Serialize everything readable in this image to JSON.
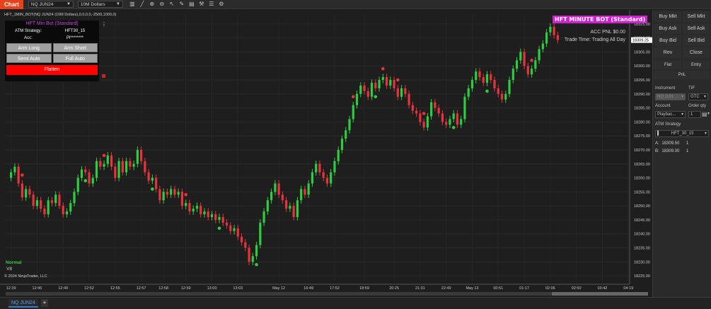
{
  "toolbar": {
    "chart_tab": "Chart",
    "instrument": "NQ JUN24",
    "interval": "10M Dollars",
    "icons": [
      "bar-chart-icon",
      "line-icon",
      "zoom-in-icon",
      "zoom-out-icon",
      "cursor-icon",
      "draw-icon",
      "properties-icon",
      "tools-icon",
      "list-icon",
      "settings-icon"
    ]
  },
  "indicator_label": "HFT_1MIN_BOT(NQ JUN24 (10M Dollars),0,0,0,0,-2500,1000,0)",
  "bot_panel": {
    "title": "HFT Min Bot (Standard)",
    "atm_label": "ATM Strategy:",
    "atm_value": "HFT30_15",
    "acc_label": "Acc:",
    "acc_value": "Pl********",
    "arm_long": "Arm Long",
    "arm_short": "Arm Short",
    "semi_auto": "Semi Auto",
    "full_auto": "Full Auto",
    "flatten": "Flatten"
  },
  "chart_info": {
    "banner": "HFT MINUTE BOT (Standard)",
    "acc_pnl": "ACC PNL $0.00",
    "trade_time": "Trade Time: Trading All Day"
  },
  "status": {
    "mode": "Normal",
    "version": "V8",
    "copyright": "© 2024 NinjaTrader, LLC"
  },
  "bottom_tab": {
    "instrument": "NQ JUN24",
    "add": "+"
  },
  "order_panel": {
    "buttons": [
      "Buy Mkt",
      "Sell Mkt",
      "Buy Ask",
      "Sell Ask",
      "Buy Bid",
      "Sell Bid",
      "Rev",
      "Close"
    ],
    "flat": "Flat",
    "entry": "Entry",
    "pnl": "PnL",
    "instrument_label": "Instrument",
    "tif_label": "TIF",
    "instrument_value": "NQ JUN",
    "tif_value": "GTC",
    "account_label": "Account",
    "order_qty_label": "Order qty",
    "account_value": "Playbac...",
    "order_qty_value": "1",
    "atm_label": "ATM Strategy",
    "atm_value": "HFT_30_15",
    "ask_label": "A:",
    "ask_price": "18309.50",
    "ask_qty": "1",
    "bid_label": "B:",
    "bid_price": "18309.00",
    "bid_qty": "1"
  },
  "colors": {
    "up": "#2ecc40",
    "down": "#e8323c",
    "accent": "#e8421a",
    "banner": "#d020d0",
    "price_marker": "#ffffff"
  },
  "chart_data": {
    "type": "candlestick",
    "y_axis": {
      "ticks": [
        18315,
        18310,
        18305,
        18300,
        18295,
        18290,
        18285,
        18280,
        18275,
        18270,
        18265,
        18260,
        18255,
        18250,
        18245,
        18240,
        18235,
        18230,
        18225
      ],
      "tick_labels": [
        "18315.00",
        "18310.00",
        "18305.00",
        "18300.00",
        "18295.00",
        "18290.00",
        "18285.00",
        "18280.00",
        "18275.00",
        "18270.00",
        "18265.00",
        "18260.00",
        "18255.00",
        "18250.00",
        "18245.00",
        "18240.00",
        "18235.00",
        "18230.00",
        "18225.00"
      ],
      "ylim": [
        18223,
        18318
      ],
      "current_price": 18309.25,
      "current_price_label": "18309.25"
    },
    "x_axis": {
      "labels": [
        "12:39",
        "12:45",
        "12:49",
        "12:52",
        "12:55",
        "12:57",
        "12:58",
        "12:59",
        "13:00",
        "13:03",
        "May 12",
        "16:49",
        "17:52",
        "18:59",
        "20:25",
        "21:31",
        "22:49",
        "May 13",
        "00:51",
        "01:17",
        "02:06",
        "02:50",
        "03:42",
        "04:19"
      ],
      "label_index": [
        0,
        7,
        14,
        21,
        28,
        35,
        41,
        47,
        54,
        61,
        72,
        80,
        87,
        95,
        103,
        110,
        117,
        124,
        131,
        138,
        145,
        152,
        159,
        166
      ]
    },
    "closes": [
      18262,
      18264,
      18258,
      18253,
      18256,
      18254,
      18250,
      18252,
      18249,
      18247,
      18252,
      18251,
      18254,
      18250,
      18247,
      18248,
      18251,
      18255,
      18260,
      18263,
      18262,
      18258,
      18260,
      18266,
      18264,
      18265,
      18268,
      18264,
      18260,
      18266,
      18262,
      18266,
      18264,
      18265,
      18270,
      18266,
      18262,
      18259,
      18260,
      18256,
      18252,
      18255,
      18254,
      18256,
      18254,
      18255,
      18250,
      18251,
      18248,
      18249,
      18250,
      18247,
      18248,
      18246,
      18247,
      18245,
      18246,
      18244,
      18243,
      18241,
      18242,
      18239,
      18237,
      18235,
      18230,
      18232,
      18236,
      18244,
      18248,
      18252,
      18255,
      18258,
      18254,
      18252,
      18249,
      18250,
      18246,
      18252,
      18256,
      18254,
      18258,
      18262,
      18265,
      18262,
      18260,
      18258,
      18262,
      18266,
      18270,
      18274,
      18277,
      18281,
      18286,
      18290,
      18293,
      18291,
      18289,
      18294,
      18292,
      18295,
      18296,
      18293,
      18295,
      18292,
      18289,
      18292,
      18290,
      18286,
      18284,
      18283,
      18280,
      18278,
      18282,
      18287,
      18285,
      18283,
      18280,
      18279,
      18281,
      18283,
      18279,
      18281,
      18289,
      18292,
      18295,
      18298,
      18296,
      18294,
      18297,
      18295,
      18292,
      18290,
      18288,
      18290,
      18295,
      18299,
      18302,
      18305,
      18300,
      18297,
      18299,
      18302,
      18306,
      18308,
      18312,
      18314,
      18311,
      18309.25
    ],
    "signals_up_marks": [
      20,
      38,
      56,
      66,
      98,
      119,
      128
    ],
    "signals_down_marks": [
      3,
      25,
      47,
      92,
      100,
      104,
      111,
      140
    ]
  }
}
